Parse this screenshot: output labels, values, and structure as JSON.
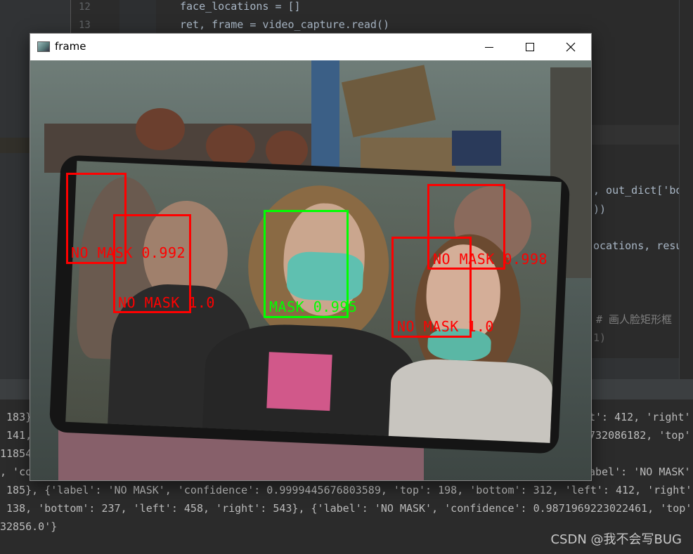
{
  "editor": {
    "line_numbers": [
      "12",
      "13"
    ],
    "lines": [
      "face_locations = []",
      "ret, frame = video_capture.read()"
    ],
    "right_fragments": [
      ", out_dict['botto",
      "))",
      "ocations, result",
      "# 画人脸矩形框",
      "1)"
    ]
  },
  "console": {
    "lines": [
      " 183},",
      " 141,",
      "11854",
      ", 'co",
      " 185}, {'label': 'NO MASK', 'confidence': 0.9999445676803589, 'top': 198, 'bottom': 312, 'left': 412, 'right':",
      " 138, 'bottom': 237, 'left': 458, 'right': 543}, {'label': 'NO MASK', 'confidence': 0.9871969223022461, 'top':",
      "32856.0'}"
    ],
    "right_fragments": [
      "t': 412, 'right':",
      "732086182, 'top':",
      "abel': 'NO MASK'"
    ]
  },
  "window": {
    "title": "frame",
    "controls": [
      "minimize",
      "maximize",
      "close"
    ]
  },
  "detections": [
    {
      "label": "NO MASK 0.992",
      "color": "#ff0000"
    },
    {
      "label": "NO MASK 1.0",
      "color": "#ff0000"
    },
    {
      "label": "MASK 0.995",
      "color": "#00ff00"
    },
    {
      "label": "NO MASK 0.998",
      "color": "#ff0000"
    },
    {
      "label": "NO MASK 1.0",
      "color": "#ff0000"
    }
  ],
  "watermark": "CSDN @我不会写BUG",
  "colors": {
    "editor_bg": "#2b2b2b",
    "code_text": "#a9b7c6",
    "no_mask": "#ff0000",
    "mask": "#00ff00"
  }
}
